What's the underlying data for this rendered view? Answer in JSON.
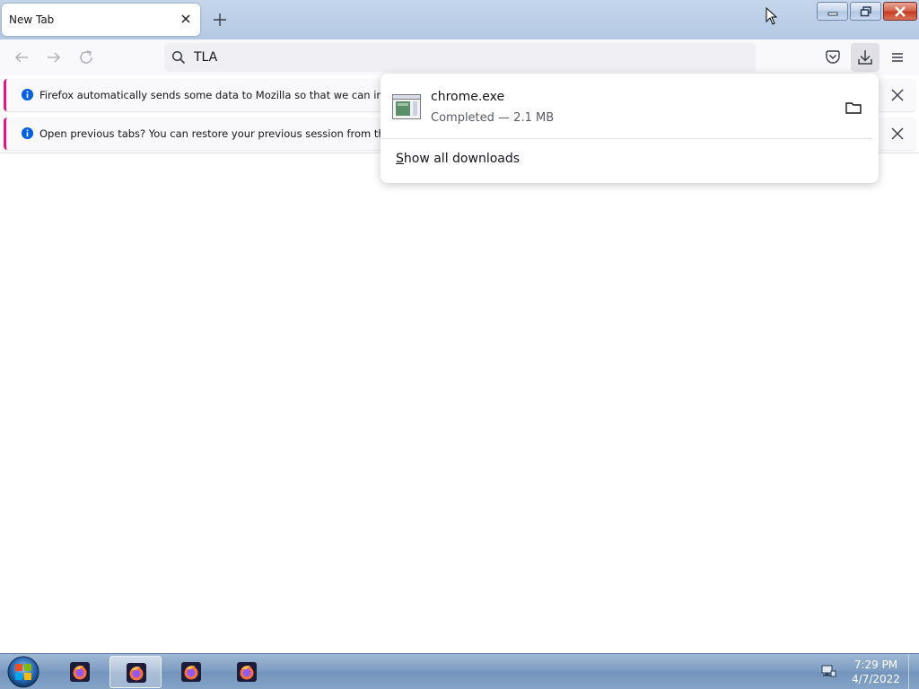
{
  "tab": {
    "title": "New Tab"
  },
  "urlbar": {
    "text": "TLA"
  },
  "notifications": [
    {
      "message": "Firefox automatically sends some data to Mozilla so that we can improve"
    },
    {
      "message": "Open previous tabs? You can restore your previous session from the Firef"
    }
  ],
  "downloads": {
    "file_name": "chrome.exe",
    "status": "Completed — 2.1 MB",
    "show_all_label": "Show all downloads",
    "show_all_accesskey": "S"
  },
  "taskbar": {
    "items": [
      {
        "icon": "firefox-icon",
        "active": false
      },
      {
        "icon": "firefox-icon",
        "active": true
      },
      {
        "icon": "firefox-icon",
        "active": false
      },
      {
        "icon": "firefox-icon",
        "active": false
      }
    ],
    "clock_time": "7:29 PM",
    "clock_date": "4/7/2022"
  },
  "colors": {
    "accent_notification": "#e31587",
    "info_icon": "#0060df",
    "tabstrip": "#b4c9e3",
    "taskbar": "#7c9ac0"
  }
}
